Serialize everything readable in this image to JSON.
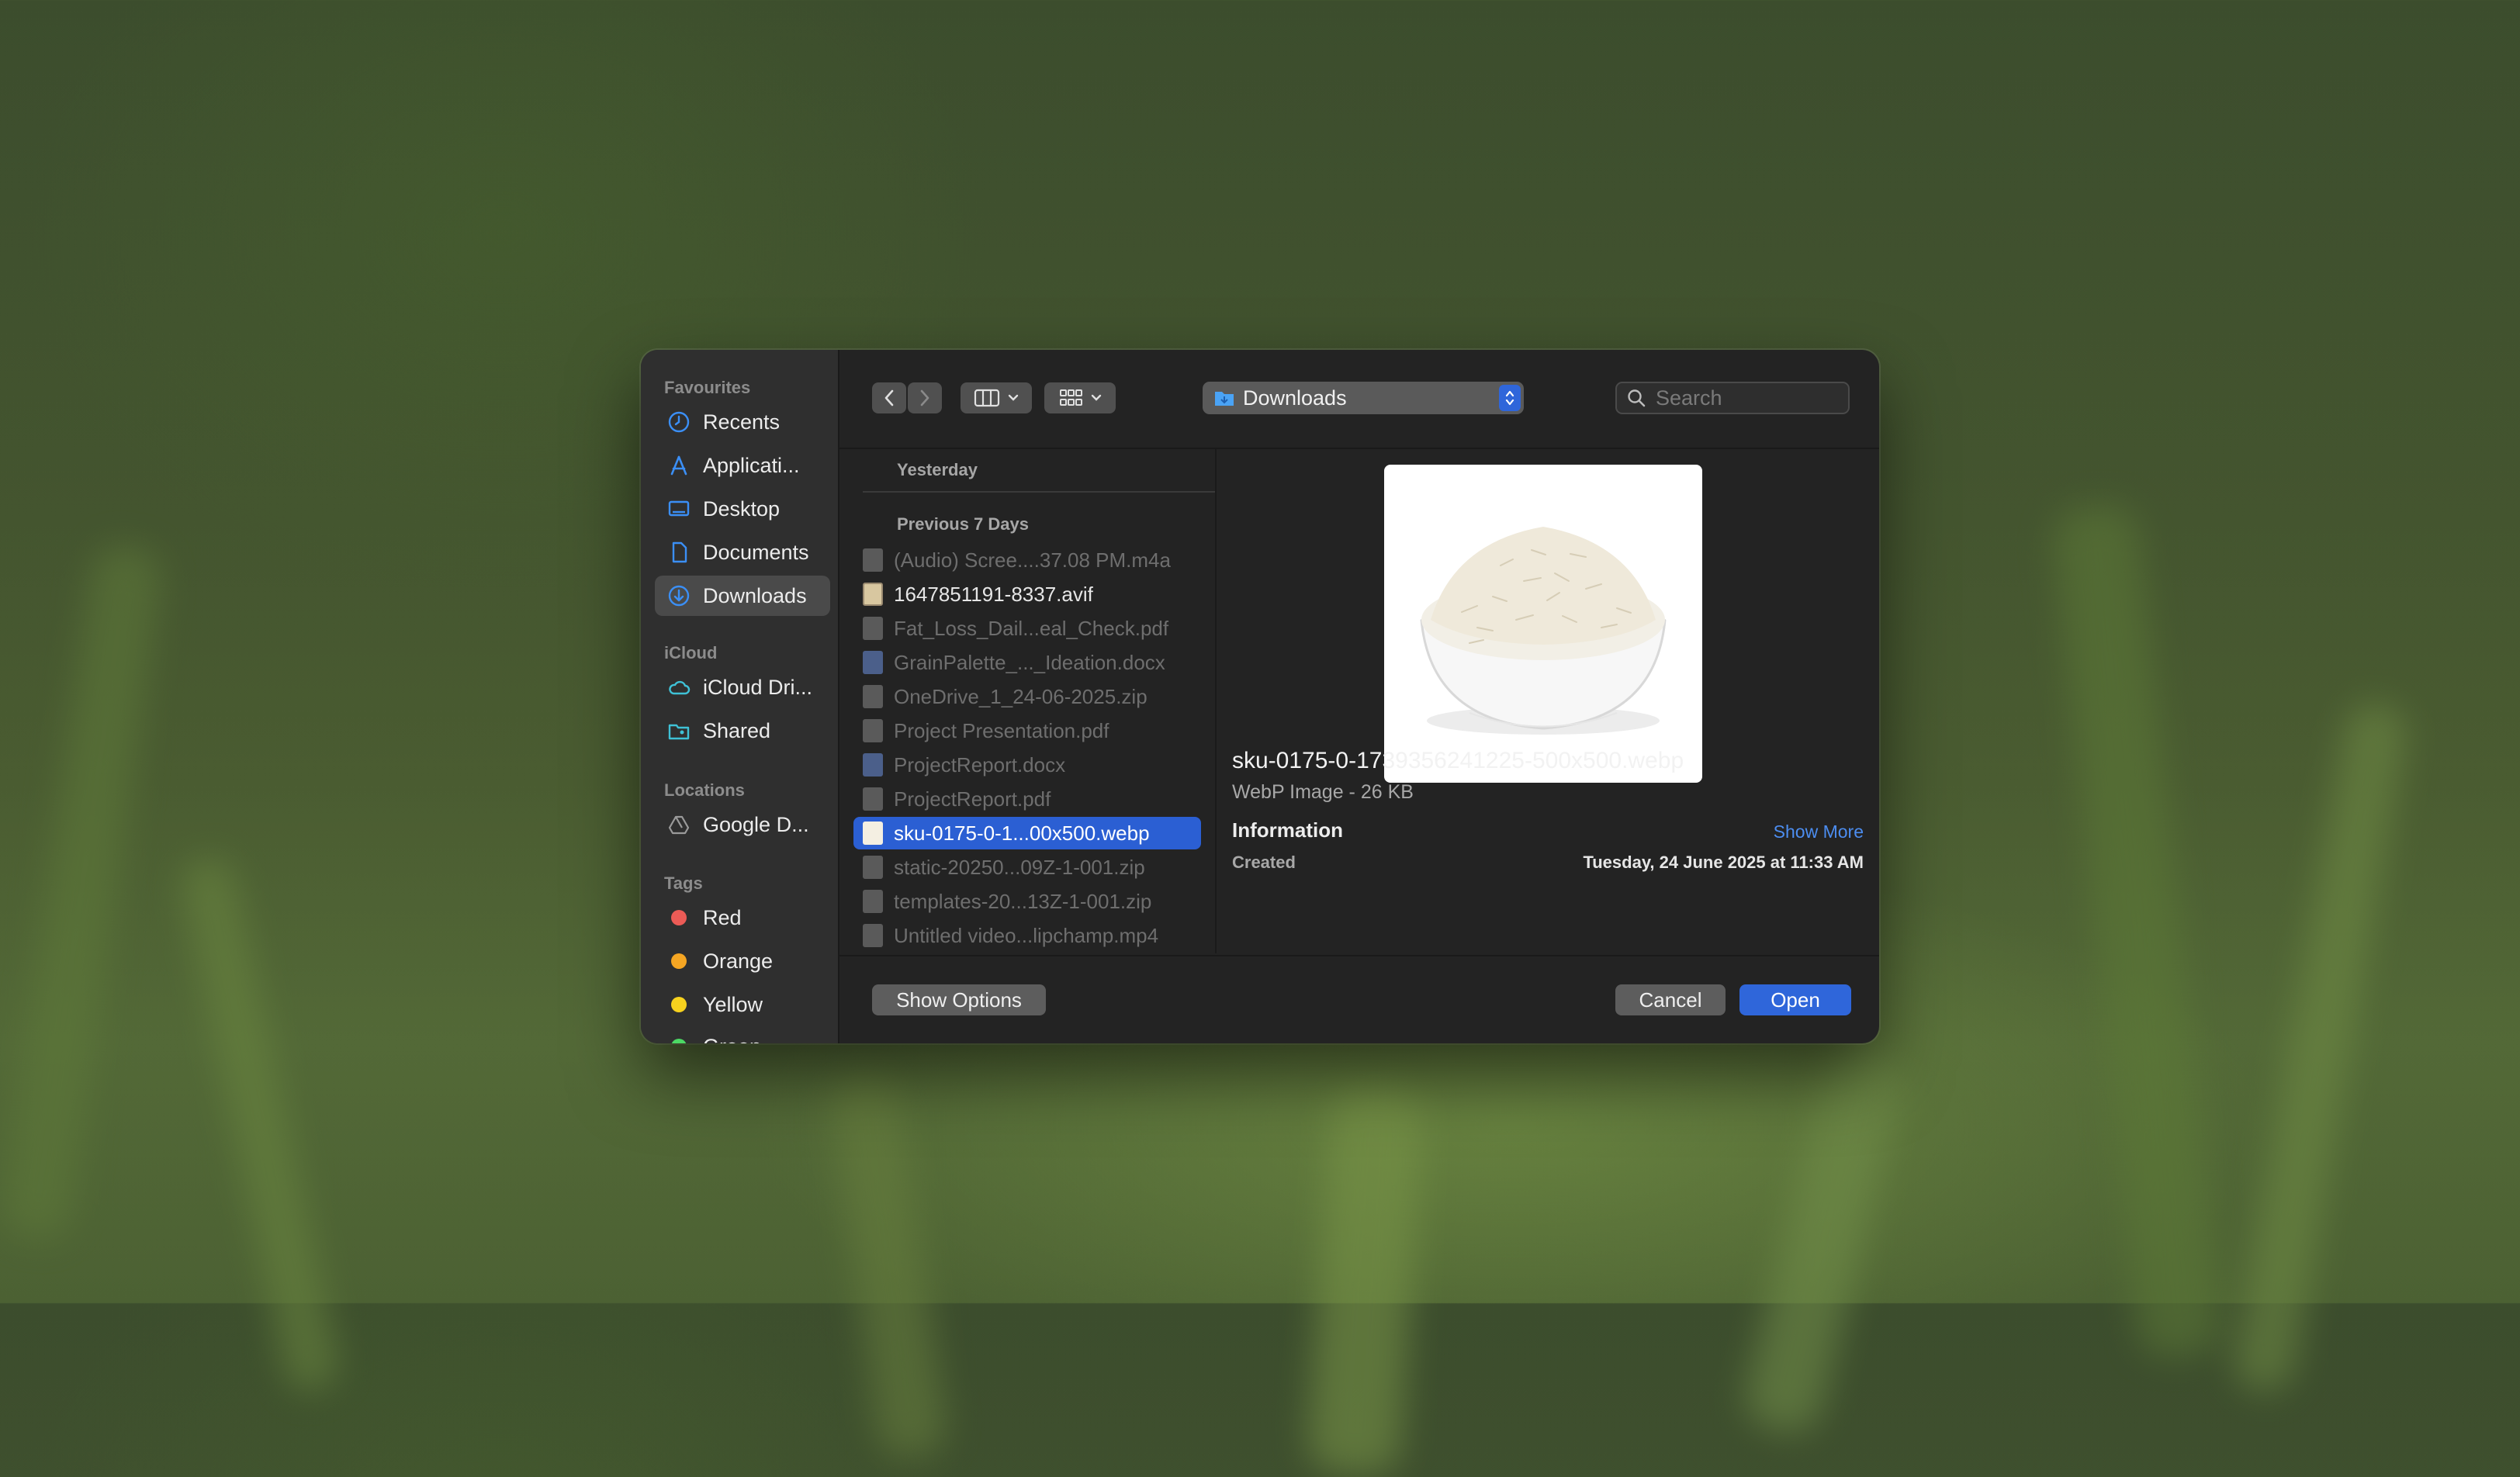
{
  "sidebar": {
    "sections": {
      "favourites": "Favourites",
      "icloud": "iCloud",
      "locations": "Locations",
      "tags": "Tags"
    },
    "favourites": [
      {
        "label": "Recents",
        "icon": "clock-icon"
      },
      {
        "label": "Applicati...",
        "icon": "applications-icon"
      },
      {
        "label": "Desktop",
        "icon": "desktop-icon"
      },
      {
        "label": "Documents",
        "icon": "document-icon"
      },
      {
        "label": "Downloads",
        "icon": "download-icon",
        "active": true
      }
    ],
    "icloud": [
      {
        "label": "iCloud Dri...",
        "icon": "cloud-icon"
      },
      {
        "label": "Shared",
        "icon": "shared-folder-icon"
      }
    ],
    "locations": [
      {
        "label": "Google D...",
        "icon": "google-drive-icon"
      }
    ],
    "tags": [
      {
        "label": "Red",
        "color": "#ec5b56"
      },
      {
        "label": "Orange",
        "color": "#f5a623"
      },
      {
        "label": "Yellow",
        "color": "#f7d21e"
      },
      {
        "label": "Green",
        "color": "#4cd964"
      }
    ]
  },
  "toolbar": {
    "location": "Downloads",
    "search_placeholder": "Search"
  },
  "filelist": {
    "groups": {
      "yesterday": "Yesterday",
      "previous": "Previous 7 Days"
    },
    "files": [
      {
        "name": "(Audio) Scree....37.08 PM.m4a",
        "icon": "audio-file-icon",
        "enabled": false
      },
      {
        "name": "1647851191-8337.avif",
        "icon": "image-file-icon",
        "enabled": true
      },
      {
        "name": "Fat_Loss_Dail...eal_Check.pdf",
        "icon": "pdf-file-icon",
        "enabled": false
      },
      {
        "name": "GrainPalette_..._Ideation.docx",
        "icon": "word-file-icon",
        "enabled": false
      },
      {
        "name": "OneDrive_1_24-06-2025.zip",
        "icon": "zip-file-icon",
        "enabled": false
      },
      {
        "name": "Project Presentation.pdf",
        "icon": "pdf-file-icon",
        "enabled": false
      },
      {
        "name": "ProjectReport.docx",
        "icon": "word-file-icon",
        "enabled": false
      },
      {
        "name": "ProjectReport.pdf",
        "icon": "pdf-file-icon",
        "enabled": false
      },
      {
        "name": "sku-0175-0-1...00x500.webp",
        "icon": "image-file-icon",
        "enabled": true,
        "selected": true
      },
      {
        "name": "static-20250...09Z-1-001.zip",
        "icon": "zip-file-icon",
        "enabled": false
      },
      {
        "name": "templates-20...13Z-1-001.zip",
        "icon": "zip-file-icon",
        "enabled": false
      },
      {
        "name": "Untitled video...lipchamp.mp4",
        "icon": "video-file-icon",
        "enabled": false
      }
    ]
  },
  "preview": {
    "filename": "sku-0175-0-1739356241225-500x500.webp",
    "kind": "WebP Image - 26 KB",
    "info_heading": "Information",
    "show_more": "Show More",
    "created_label": "Created",
    "created_value": "Tuesday, 24 June 2025 at 11:33 AM"
  },
  "buttons": {
    "show_options": "Show Options",
    "cancel": "Cancel",
    "open": "Open"
  }
}
